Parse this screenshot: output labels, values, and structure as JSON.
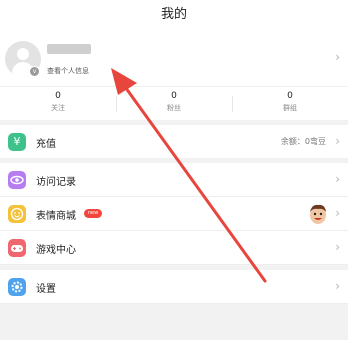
{
  "header": {
    "title": "我的"
  },
  "profile": {
    "hint": "查看个人信息"
  },
  "stats": [
    {
      "count": "0",
      "label": "关注"
    },
    {
      "count": "0",
      "label": "粉丝"
    },
    {
      "count": "0",
      "label": "群组"
    }
  ],
  "menu": {
    "recharge": {
      "label": "充值",
      "icon": "recharge-icon",
      "color": "#3ec28c",
      "balance": "余额：0弯豆"
    },
    "history": {
      "label": "访问记录",
      "icon": "eye-icon",
      "color": "#b77df0"
    },
    "emoji_store": {
      "label": "表情商城",
      "icon": "smile-icon",
      "color": "#f4c23a",
      "badge": "new"
    },
    "game_center": {
      "label": "游戏中心",
      "icon": "gamepad-icon",
      "color": "#f0676f"
    },
    "settings": {
      "label": "设置",
      "icon": "gear-icon",
      "color": "#4fa3ee"
    }
  },
  "annotation": {
    "color": "#e8453c"
  }
}
